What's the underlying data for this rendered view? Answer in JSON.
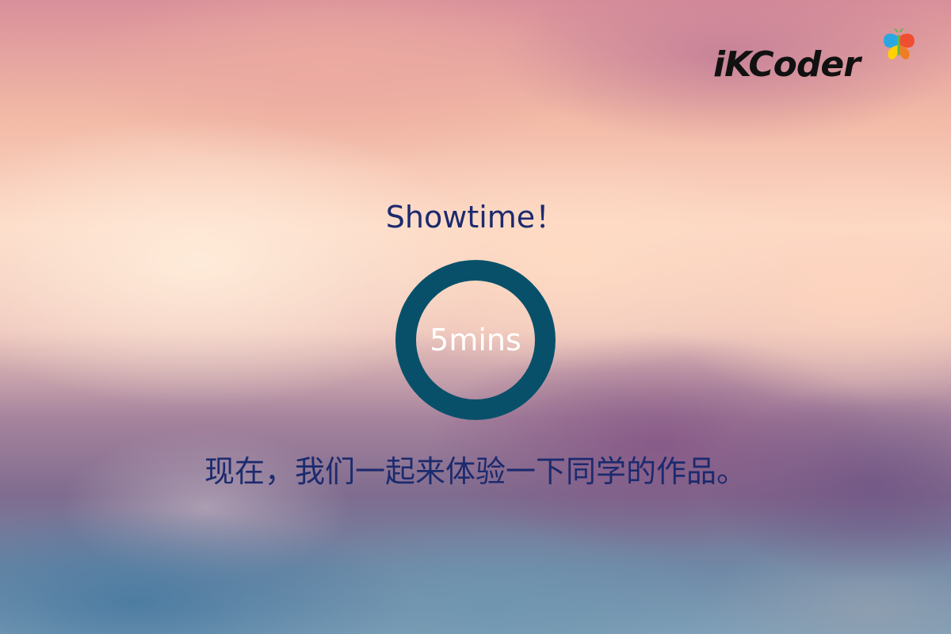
{
  "brand": {
    "name": "iKCoder",
    "text_color": "#111111",
    "butterfly_colors": [
      "#f04e30",
      "#2aa7e0",
      "#ffd100",
      "#5fb94a"
    ]
  },
  "slide": {
    "title": "Showtime！",
    "timer_label": "5mins",
    "timer_ring_color": "#08506a",
    "message": "现在，我们一起来体验一下同学的作品。",
    "text_color": "#1c2a6e"
  }
}
